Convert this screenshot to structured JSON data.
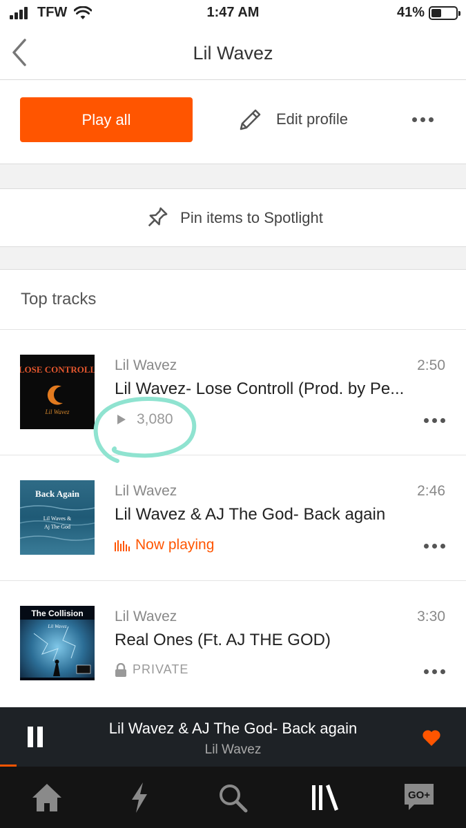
{
  "status_bar": {
    "carrier": "TFW",
    "time": "1:47 AM",
    "battery": "41%",
    "battery_level": 0.41
  },
  "header": {
    "title": "Lil Wavez",
    "back_icon": "chevron-left-icon"
  },
  "actions": {
    "play_all": "Play all",
    "edit_profile": "Edit profile",
    "more_icon": "more-icon"
  },
  "spotlight": {
    "label": "Pin items to Spotlight",
    "icon": "pin-icon"
  },
  "top_tracks": {
    "title": "Top tracks",
    "tracks": [
      {
        "artist": "Lil Wavez",
        "duration": "2:50",
        "title": "Lil Wavez- Lose Controll (Prod. by Pe...",
        "meta_type": "plays",
        "plays": "3,080",
        "art_text": "LOSE CONTROLL",
        "art_sub": "Lil Wavez"
      },
      {
        "artist": "Lil Wavez",
        "duration": "2:46",
        "title": "Lil Wavez & AJ The God- Back again",
        "meta_type": "now_playing",
        "status": "Now playing",
        "art_text": "Back Again",
        "art_sub_1": "Lil Waves &",
        "art_sub_2": "Aj The God"
      },
      {
        "artist": "Lil Wavez",
        "duration": "3:30",
        "title": "Real Ones (Ft. AJ THE GOD)",
        "meta_type": "private",
        "status": "PRIVATE",
        "art_text": "The Collision",
        "art_sub": "Lil Wavez"
      }
    ]
  },
  "mini_player": {
    "title": "Lil Wavez & AJ The God- Back again",
    "artist": "Lil Wavez",
    "liked": true
  },
  "tab_bar": {
    "tabs": [
      {
        "icon": "home-icon"
      },
      {
        "icon": "stream-icon"
      },
      {
        "icon": "search-icon"
      },
      {
        "icon": "library-icon"
      },
      {
        "icon": "go-plus-icon",
        "label": "GO+"
      }
    ]
  },
  "colors": {
    "accent": "#ff5500",
    "annotation": "#8fe3d0",
    "player_bg": "#1e2226",
    "tabbar_bg": "#141414"
  }
}
